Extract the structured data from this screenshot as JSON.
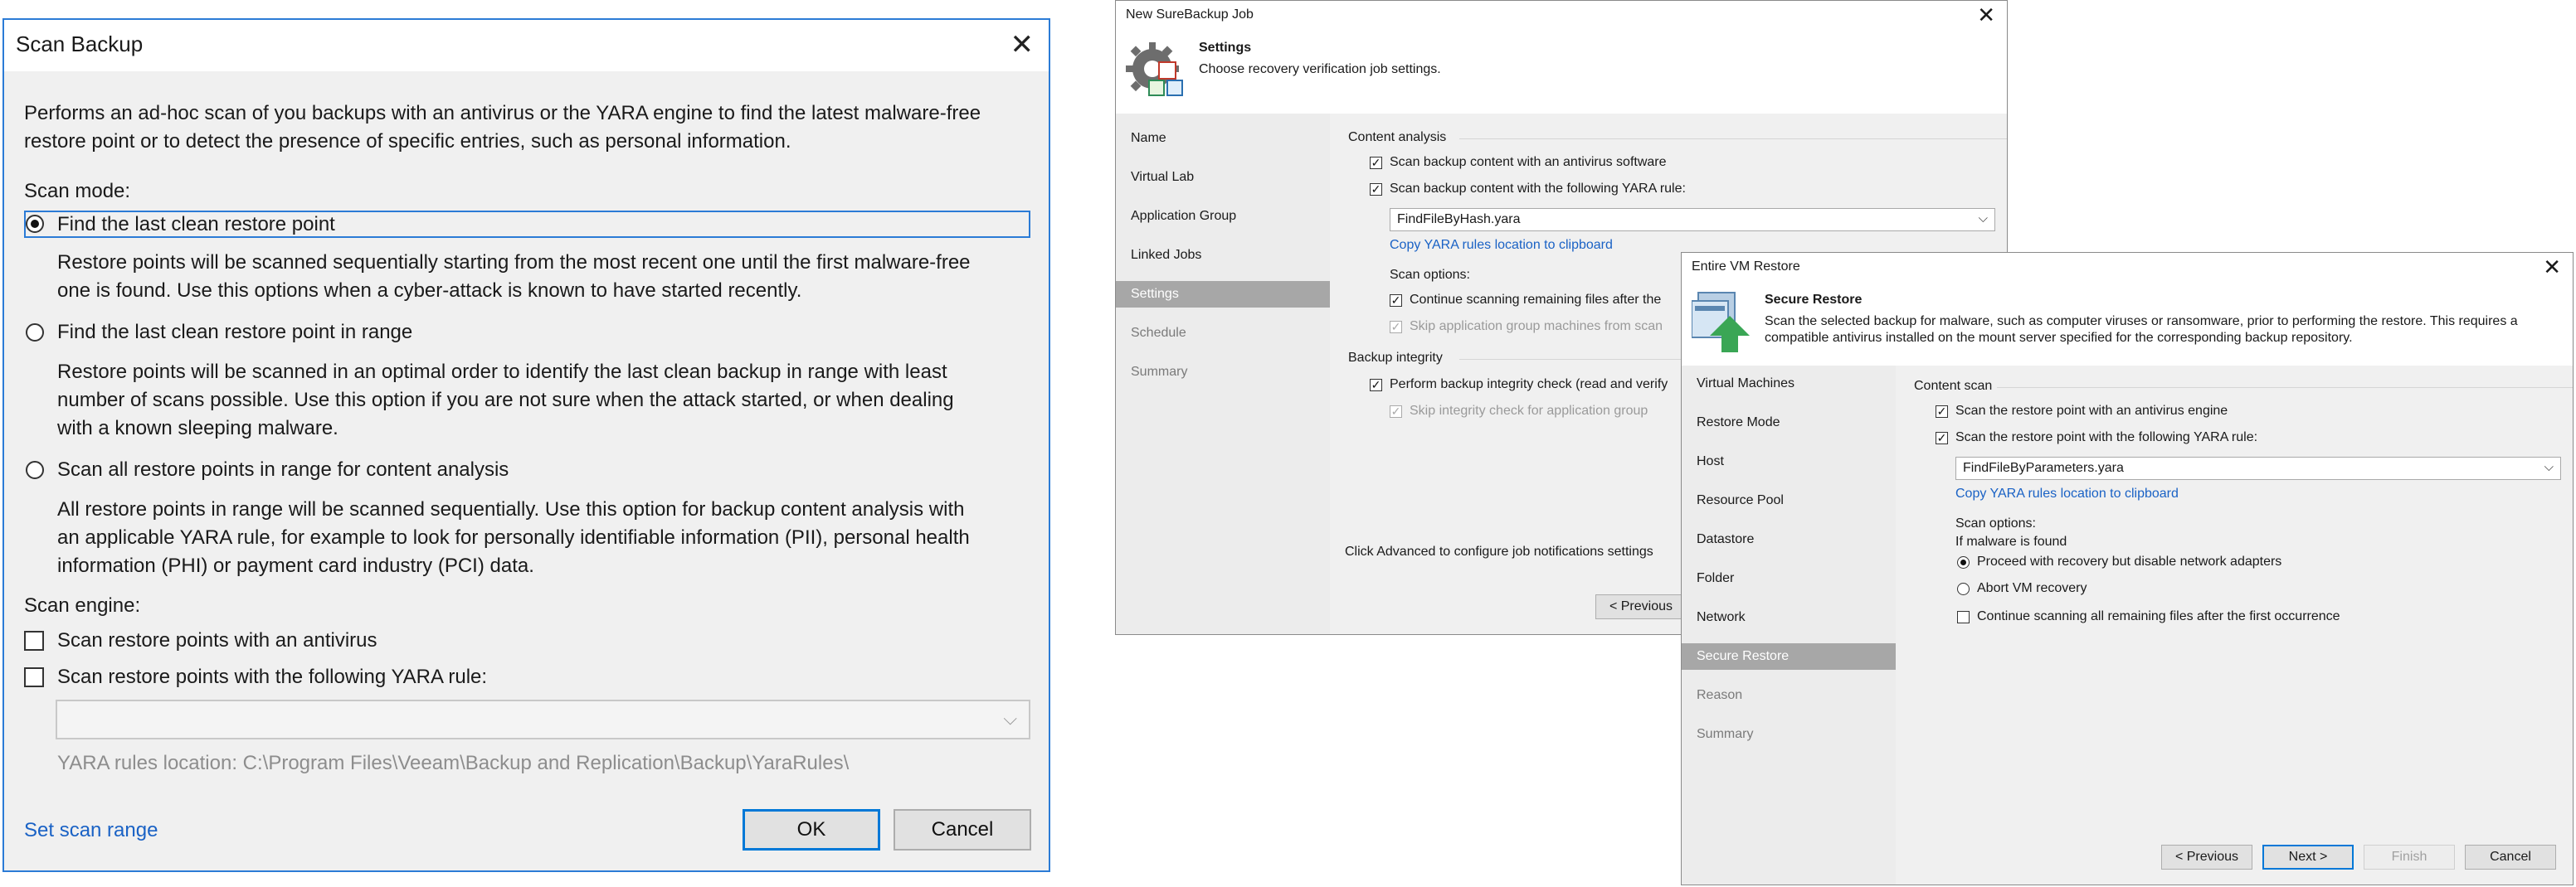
{
  "scan_dialog": {
    "title": "Scan Backup",
    "description_line1": "Performs an ad-hoc scan of you backups with an antivirus or the YARA engine to find the latest malware-free",
    "description_line2": "restore point or to detect the presence of specific entries, such as personal information.",
    "scan_mode_label": "Scan mode:",
    "options": [
      {
        "label": "Find the last clean restore point",
        "selected": true,
        "desc": [
          "Restore points will be scanned sequentially starting from the most recent one until the first malware-free",
          "one is found. Use this options when a cyber-attack is known to have started recently."
        ]
      },
      {
        "label": "Find the last clean restore point in range",
        "selected": false,
        "desc": [
          "Restore points will be scanned in an optimal order to identify the last clean backup in range with least",
          "number of scans possible. Use this option if you are not sure when the attack started, or when dealing",
          "with a known sleeping malware."
        ]
      },
      {
        "label": "Scan all restore points in range for content analysis",
        "selected": false,
        "desc": [
          "All restore points in range will be scanned sequentially. Use this option for backup content analysis with",
          "an applicable YARA rule, for example to look for personally identifiable information (PII), personal health",
          "information (PHI) or payment card industry (PCI) data."
        ]
      }
    ],
    "scan_engine_label": "Scan engine:",
    "antivirus_label": "Scan restore points with an antivirus",
    "yara_label": "Scan restore points with the following YARA rule:",
    "yara_value": "",
    "yara_location": "YARA rules location: C:\\Program Files\\Veeam\\Backup and Replication\\Backup\\YaraRules\\",
    "set_scan_range": "Set scan range",
    "ok": "OK",
    "cancel": "Cancel"
  },
  "surebackup": {
    "title": "New SureBackup Job",
    "header_title": "Settings",
    "header_subtitle": "Choose recovery verification job settings.",
    "nav": [
      {
        "label": "Name",
        "state": "normal"
      },
      {
        "label": "Virtual Lab",
        "state": "normal"
      },
      {
        "label": "Application Group",
        "state": "normal"
      },
      {
        "label": "Linked Jobs",
        "state": "normal"
      },
      {
        "label": "Settings",
        "state": "active"
      },
      {
        "label": "Schedule",
        "state": "dim"
      },
      {
        "label": "Summary",
        "state": "dim"
      }
    ],
    "content_analysis": "Content analysis",
    "chk_antivirus": "Scan backup content with an antivirus software",
    "chk_yara": "Scan backup content with the following YARA rule:",
    "yara_value": "FindFileByHash.yara",
    "copy_link": "Copy YARA rules location to clipboard",
    "scan_options": "Scan options:",
    "chk_continue": "Continue scanning remaining files after the",
    "chk_skip_group": "Skip application group machines from scan",
    "backup_integrity": "Backup integrity",
    "chk_integrity": "Perform backup integrity check (read and verify",
    "chk_skip_integrity": "Skip integrity check for application group",
    "footer_note": "Click Advanced to configure job notifications settings",
    "previous": "< Previous"
  },
  "vm_restore": {
    "title": "Entire VM Restore",
    "header_title": "Secure Restore",
    "header_subtitle_1": "Scan the selected backup for malware, such as computer viruses or ransomware, prior to performing the restore. This requires a",
    "header_subtitle_2": "compatible antivirus installed on the mount server specified for the corresponding backup repository.",
    "nav": [
      {
        "label": "Virtual Machines",
        "state": "normal"
      },
      {
        "label": "Restore Mode",
        "state": "normal"
      },
      {
        "label": "Host",
        "state": "normal"
      },
      {
        "label": "Resource Pool",
        "state": "normal"
      },
      {
        "label": "Datastore",
        "state": "normal"
      },
      {
        "label": "Folder",
        "state": "normal"
      },
      {
        "label": "Network",
        "state": "normal"
      },
      {
        "label": "Secure Restore",
        "state": "active"
      },
      {
        "label": "Reason",
        "state": "dim"
      },
      {
        "label": "Summary",
        "state": "dim"
      }
    ],
    "content_scan": "Content scan",
    "chk_antivirus": "Scan the restore point with an antivirus engine",
    "chk_yara": "Scan the restore point with the following YARA rule:",
    "yara_value": "FindFileByParameters.yara",
    "copy_link": "Copy YARA rules location to clipboard",
    "scan_options": "Scan options:",
    "if_malware": "If malware is found",
    "radio_proceed": "Proceed with recovery but disable network adapters",
    "radio_abort": "Abort VM recovery",
    "chk_continue": "Continue scanning all remaining files after the first occurrence",
    "previous": "< Previous",
    "next": "Next >",
    "finish": "Finish",
    "cancel": "Cancel"
  }
}
